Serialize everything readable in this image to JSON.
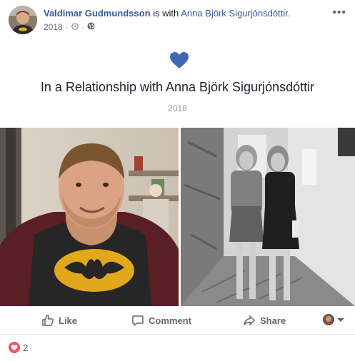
{
  "post": {
    "author": "Valdimar Gudmundsson",
    "with_text": "is with",
    "tagged": "Anna Björk Sigurjónsdóttir.",
    "year": "2018",
    "separator": "·",
    "more_label": "•••"
  },
  "life_event": {
    "title": "In a Relationship with Anna Björk Sigurjónsdóttir",
    "year": "2018",
    "icon": "heart-icon",
    "icon_color": "#4267b2"
  },
  "photos": [
    {
      "subject": "man in batman t-shirt"
    },
    {
      "subject": "two women in alley (black and white)"
    }
  ],
  "actions": {
    "like": "Like",
    "comment": "Comment",
    "share": "Share"
  },
  "reactions": {
    "count": "2",
    "icon": "love-icon",
    "color": "#f25268"
  },
  "colors": {
    "link": "#365899",
    "muted": "#616770",
    "text": "#1d2129"
  }
}
